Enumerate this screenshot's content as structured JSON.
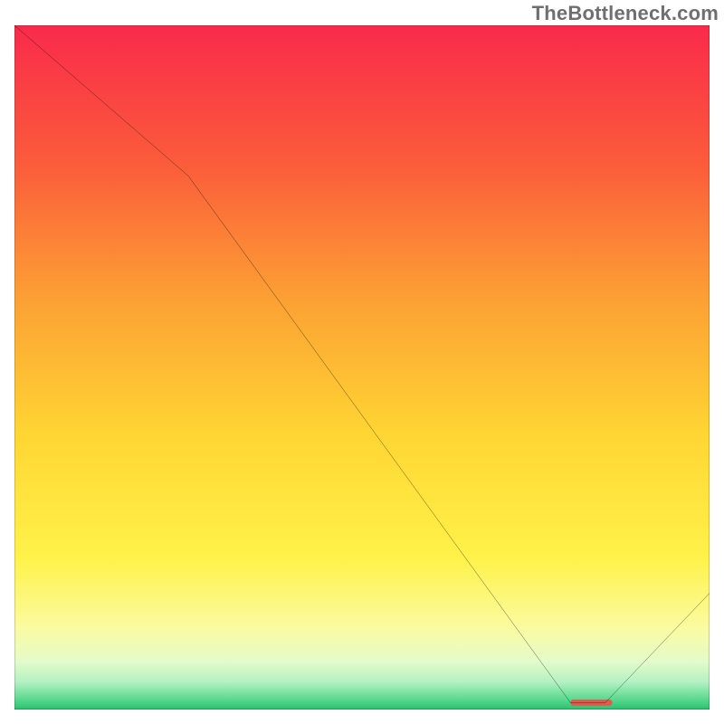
{
  "watermark": "TheBottleneck.com",
  "chart_data": {
    "type": "line",
    "title": "",
    "xlabel": "",
    "ylabel": "",
    "xlim": [
      0,
      100
    ],
    "ylim": [
      0,
      100
    ],
    "grid": false,
    "legend": false,
    "background": {
      "type": "vertical-gradient",
      "stops": [
        {
          "pos": 0.0,
          "color": "#f92a4b"
        },
        {
          "pos": 0.2,
          "color": "#fb5b3b"
        },
        {
          "pos": 0.4,
          "color": "#fca034"
        },
        {
          "pos": 0.6,
          "color": "#ffd633"
        },
        {
          "pos": 0.78,
          "color": "#fff24a"
        },
        {
          "pos": 0.88,
          "color": "#fbfba0"
        },
        {
          "pos": 0.93,
          "color": "#e4fbca"
        },
        {
          "pos": 0.96,
          "color": "#b3f1c2"
        },
        {
          "pos": 0.985,
          "color": "#5ad98f"
        },
        {
          "pos": 1.0,
          "color": "#2abf6d"
        }
      ]
    },
    "series": [
      {
        "name": "bottleneck-curve",
        "x": [
          0,
          25,
          80,
          85,
          100
        ],
        "y": [
          100,
          78,
          1,
          1,
          17
        ]
      }
    ],
    "markers": [
      {
        "name": "optimal-segment",
        "shape": "bar",
        "x_start": 80,
        "x_end": 86,
        "y": 1,
        "color": "#e15a4d"
      }
    ]
  }
}
